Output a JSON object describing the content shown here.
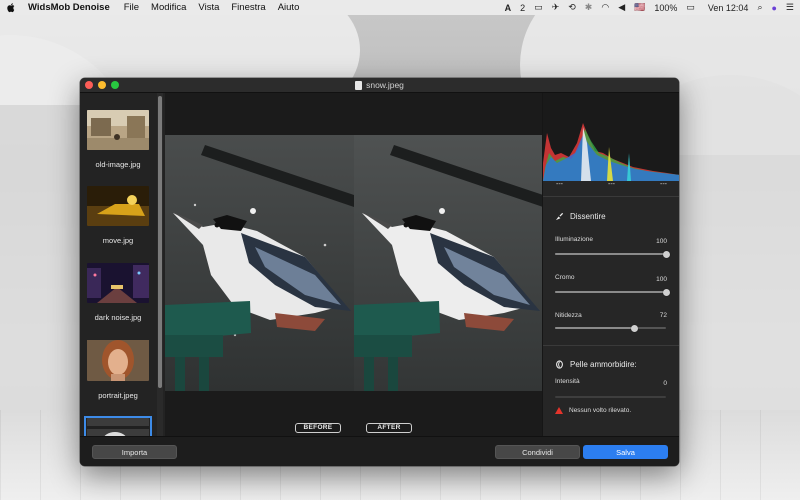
{
  "menubar": {
    "app_name": "WidsMob Denoise",
    "menus": [
      "File",
      "Modifica",
      "Vista",
      "Finestra",
      "Aiuto"
    ],
    "status": {
      "input_badge": "2",
      "flag": "🇺🇸",
      "battery": "100%",
      "clock": "Ven 12:04"
    }
  },
  "window": {
    "title": "snow.jpeg"
  },
  "sidebar": {
    "items": [
      {
        "label": "old-image.jpg",
        "selected": false
      },
      {
        "label": "move.jpg",
        "selected": false
      },
      {
        "label": "dark noise.jpg",
        "selected": false
      },
      {
        "label": "portrait.jpeg",
        "selected": false
      },
      {
        "label": "",
        "selected": true
      }
    ]
  },
  "canvas": {
    "before_label": "BEFORE",
    "after_label": "AFTER"
  },
  "panel": {
    "histogram_stats": [
      "---",
      "---",
      "---"
    ],
    "denoise": {
      "title": "Dissentire",
      "controls": [
        {
          "label": "Illuminazione",
          "value": "100",
          "level": 1.0
        },
        {
          "label": "Cromo",
          "value": "100",
          "level": 1.0
        },
        {
          "label": "Nitidezza",
          "value": "72",
          "level": 0.72
        }
      ]
    },
    "skin": {
      "title": "Pelle ammorbidire:",
      "intensity_label": "Intensità",
      "intensity_value": "0",
      "intensity_level": 0,
      "warning": "Nessun volto rilevato."
    }
  },
  "bottombar": {
    "import_label": "Importa",
    "share_label": "Condividi",
    "save_label": "Salva"
  },
  "colors": {
    "accent": "#2c7ef0",
    "warning": "#e4342b"
  }
}
